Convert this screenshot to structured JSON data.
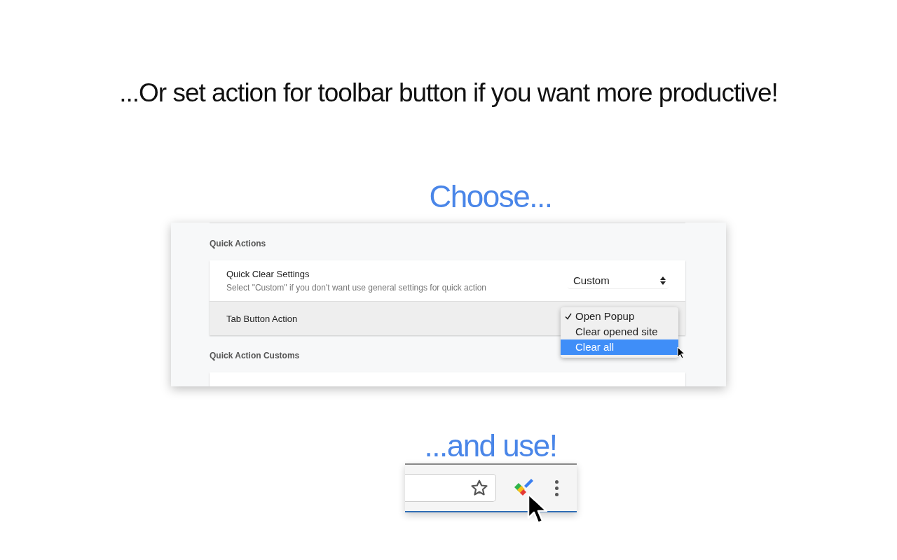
{
  "headline": "...Or set action for toolbar button if you want more productive!",
  "choose_caption": "Choose...",
  "settings": {
    "sections": [
      {
        "title": "Quick Actions",
        "rows": [
          {
            "kind": "select",
            "label": "Quick Clear Settings",
            "description": "Select \"Custom\" if you don't want use general settings for quick action",
            "value": "Custom"
          },
          {
            "kind": "menu",
            "label": "Tab Button Action",
            "options": [
              {
                "label": "Open Popup",
                "checked": true,
                "selected": false
              },
              {
                "label": "Clear opened site",
                "checked": false,
                "selected": false
              },
              {
                "label": "Clear all",
                "checked": false,
                "selected": true
              }
            ]
          }
        ]
      },
      {
        "title": "Quick Action Customs",
        "rows": [
          {
            "kind": "partial"
          }
        ]
      }
    ]
  },
  "use_caption": "...and use!"
}
